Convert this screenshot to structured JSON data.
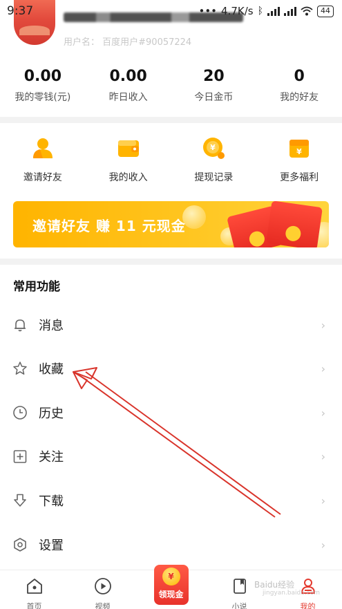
{
  "status_bar": {
    "time": "9:37",
    "dots": "•••",
    "network_speed": "4.7K/s",
    "battery": "44"
  },
  "profile": {
    "user_id": "用户名： 百度用户#90057224"
  },
  "stats": [
    {
      "value": "0.00",
      "label": "我的零钱(元)"
    },
    {
      "value": "0.00",
      "label": "昨日收入"
    },
    {
      "value": "20",
      "label": "今日金币"
    },
    {
      "value": "0",
      "label": "我的好友"
    }
  ],
  "quick_actions": [
    {
      "label": "邀请好友",
      "icon": "person-icon"
    },
    {
      "label": "我的收入",
      "icon": "wallet-icon"
    },
    {
      "label": "提现记录",
      "icon": "coin-yen-icon"
    },
    {
      "label": "更多福利",
      "icon": "gift-icon"
    }
  ],
  "banner": {
    "text": "邀请好友 赚 11 元现金"
  },
  "common_functions": {
    "title": "常用功能",
    "items": [
      {
        "label": "消息",
        "icon": "bell-icon",
        "chevron": "›"
      },
      {
        "label": "收藏",
        "icon": "star-icon",
        "chevron": "›"
      },
      {
        "label": "历史",
        "icon": "clock-icon",
        "chevron": "›"
      },
      {
        "label": "关注",
        "icon": "add-box-icon",
        "chevron": "›"
      },
      {
        "label": "下载",
        "icon": "download-icon",
        "chevron": "›"
      },
      {
        "label": "设置",
        "icon": "settings-icon",
        "chevron": "›"
      }
    ]
  },
  "bottom_nav": {
    "items": [
      {
        "label": "首页",
        "icon": "home-icon"
      },
      {
        "label": "视频",
        "icon": "play-icon"
      },
      {
        "label": "领现金",
        "icon": "yen-coin-icon",
        "coin_symbol": "¥"
      },
      {
        "label": "小说",
        "icon": "book-icon"
      },
      {
        "label": "我的",
        "icon": "profile-icon"
      }
    ],
    "active": "我的"
  },
  "watermark": {
    "text": "Baidu经验",
    "sub": "jingyan.baidu.com"
  },
  "colors": {
    "accent_red": "#e43a2f",
    "banner_yellow": "#ffb400",
    "annotation_arrow": "#d9342b"
  }
}
